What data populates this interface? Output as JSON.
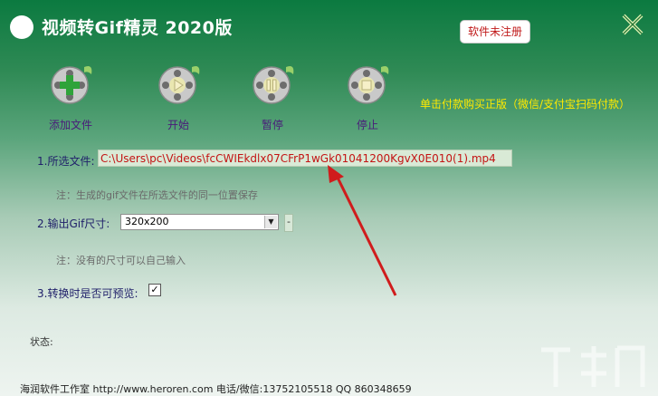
{
  "window": {
    "title": "视频转Gif精灵 2020版",
    "register_badge": "软件未注册"
  },
  "toolbar": {
    "add_file": "添加文件",
    "start": "开始",
    "pause": "暂停",
    "stop": "停止",
    "promo": "单击付款购买正版（微信/支付宝扫码付款）"
  },
  "form": {
    "file_label": "1.所选文件:",
    "file_path": "C:\\Users\\pc\\Videos\\fcCWIEkdlx07CFrP1wGk01041200KgvX0E010(1).mp4",
    "file_note": "注：生成的gif文件在所选文件的同一位置保存",
    "size_label": "2.输出Gif尺寸:",
    "size_value": "320x200",
    "size_extra_button": "-",
    "size_note": "注：没有的尺寸可以自己输入",
    "preview_label": "3.转换时是否可预览:",
    "preview_checked": "✓"
  },
  "status": {
    "label": "状态:"
  },
  "footer": {
    "text": "海润软件工作室 http://www.heroren.com  电话/微信:13752105518  QQ 860348659"
  },
  "colors": {
    "title_bar": "#0b7a40",
    "path_text": "#c41414",
    "promo_text": "#ffea00",
    "register_text": "#c01818",
    "arrow": "#d01c1c"
  },
  "icons": [
    "app-logo",
    "close-icon",
    "add-icon",
    "play-icon",
    "pause-icon",
    "stop-icon",
    "dropdown-arrow-icon",
    "checkbox-check-icon"
  ]
}
